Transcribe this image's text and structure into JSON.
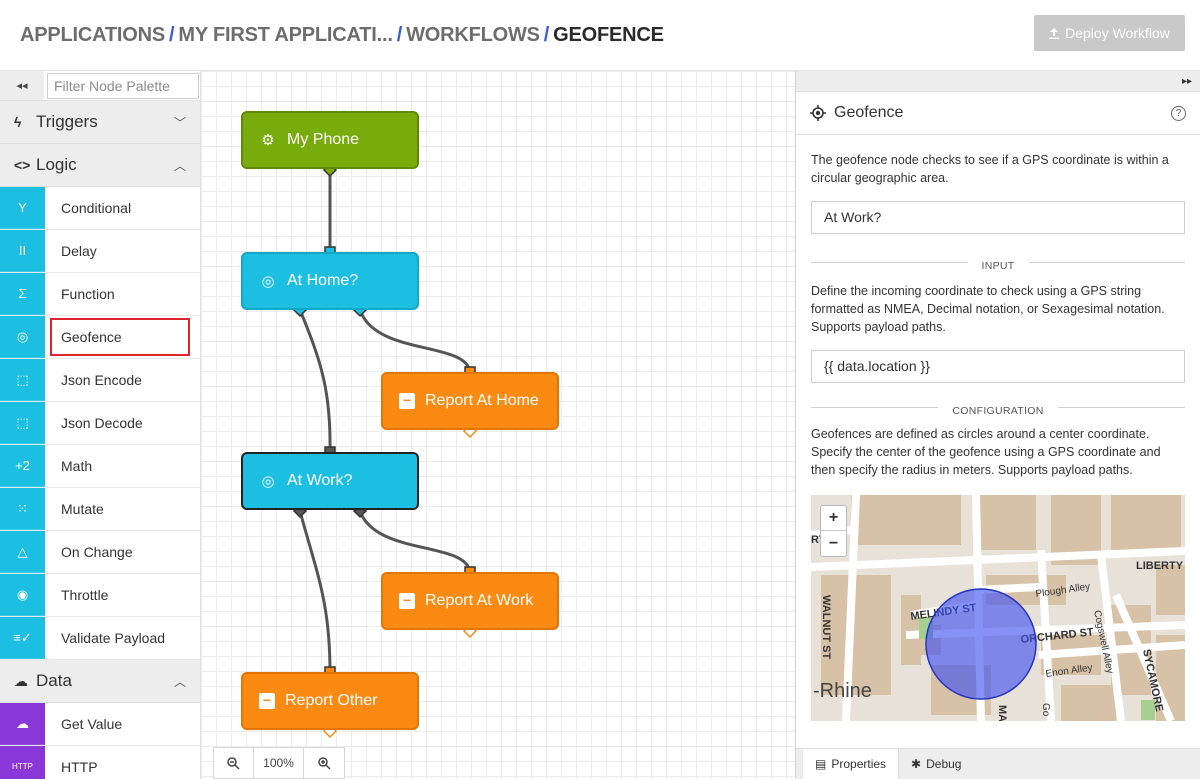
{
  "breadcrumb": {
    "items": [
      "APPLICATIONS",
      "MY FIRST APPLICATI...",
      "WORKFLOWS"
    ],
    "current": "GEOFENCE",
    "separator": "/"
  },
  "deploy_button": {
    "label": "Deploy Workflow",
    "icon": "upload-icon",
    "state": "disabled"
  },
  "palette": {
    "filter_placeholder": "Filter Node Palette",
    "collapse_icon": "◂◂",
    "categories": {
      "triggers": {
        "label": "Triggers",
        "icon": "lightning-icon",
        "chevron": "⌄"
      },
      "logic": {
        "label": "Logic",
        "icon": "code-icon",
        "chevron": "⌃"
      },
      "data": {
        "label": "Data",
        "icon": "cloud-download-icon",
        "chevron": "⌃"
      }
    },
    "logic_items": [
      {
        "label": "Conditional",
        "icon": "split-icon",
        "glyph": "Y"
      },
      {
        "label": "Delay",
        "icon": "pause-icon",
        "glyph": "II"
      },
      {
        "label": "Function",
        "icon": "sigma-icon",
        "glyph": "Σ"
      },
      {
        "label": "Geofence",
        "icon": "crosshair-icon",
        "glyph": "◎",
        "highlighted": true
      },
      {
        "label": "Json Encode",
        "icon": "json-encode-icon",
        "glyph": "⬚"
      },
      {
        "label": "Json Decode",
        "icon": "json-decode-icon",
        "glyph": "⬚"
      },
      {
        "label": "Math",
        "icon": "math-icon",
        "glyph": "+2"
      },
      {
        "label": "Mutate",
        "icon": "mutate-icon",
        "glyph": "⁙"
      },
      {
        "label": "On Change",
        "icon": "triangle-icon",
        "glyph": "△"
      },
      {
        "label": "Throttle",
        "icon": "throttle-icon",
        "glyph": "◉"
      },
      {
        "label": "Validate Payload",
        "icon": "validate-icon",
        "glyph": "≡✓"
      }
    ],
    "data_items": [
      {
        "label": "Get Value",
        "icon": "cloud-download-icon",
        "glyph": "☁"
      },
      {
        "label": "HTTP",
        "icon": "http-icon",
        "glyph": "HTTP"
      }
    ]
  },
  "canvas": {
    "nodes": [
      {
        "label": "My Phone",
        "kind": "device",
        "color": "#78ab0c"
      },
      {
        "label": "At Home?",
        "kind": "geofence",
        "color": "#1cbfe1"
      },
      {
        "label": "Report At Home",
        "kind": "output",
        "color": "#fb8a12"
      },
      {
        "label": "At Work?",
        "kind": "geofence",
        "color": "#1cbfe1",
        "selected": true
      },
      {
        "label": "Report At Work",
        "kind": "output",
        "color": "#fb8a12"
      },
      {
        "label": "Report Other",
        "kind": "output",
        "color": "#fb8a12"
      }
    ],
    "zoom": {
      "level": "100%",
      "zoom_out_icon": "zoom-out-icon",
      "zoom_in_icon": "zoom-in-icon"
    }
  },
  "panel": {
    "expand_icon": "▸▸",
    "title": "Geofence",
    "help": "?",
    "description": "The geofence node checks to see if a GPS coordinate is within a circular geographic area.",
    "name_value": "At Work?",
    "input_heading": "INPUT",
    "input_description": "Define the incoming coordinate to check using a GPS string formatted as NMEA, Decimal notation, or Sexagesimal notation. Supports payload paths.",
    "input_value": "{{ data.location }}",
    "config_heading": "CONFIGURATION",
    "config_description": "Geofences are defined as circles around a center coordinate. Specify the center of the geofence using a GPS coordinate and then specify the radius in meters. Supports payload paths.",
    "map": {
      "zoom_in": "+",
      "zoom_out": "−",
      "labels": [
        "MELINDY ST",
        "ORCHARD ST",
        "Plough Alley",
        "Cogswell Alley",
        "Enon Alley",
        "WALNUT ST",
        "SYCAMORE",
        "LIBERTY",
        "-Rhine",
        "RT",
        "MA",
        "Go"
      ],
      "circle_color": "#3d4ff0"
    },
    "tabs": [
      {
        "label": "Properties",
        "icon": "document-icon",
        "active": true
      },
      {
        "label": "Debug",
        "icon": "bug-icon",
        "active": false
      }
    ]
  }
}
